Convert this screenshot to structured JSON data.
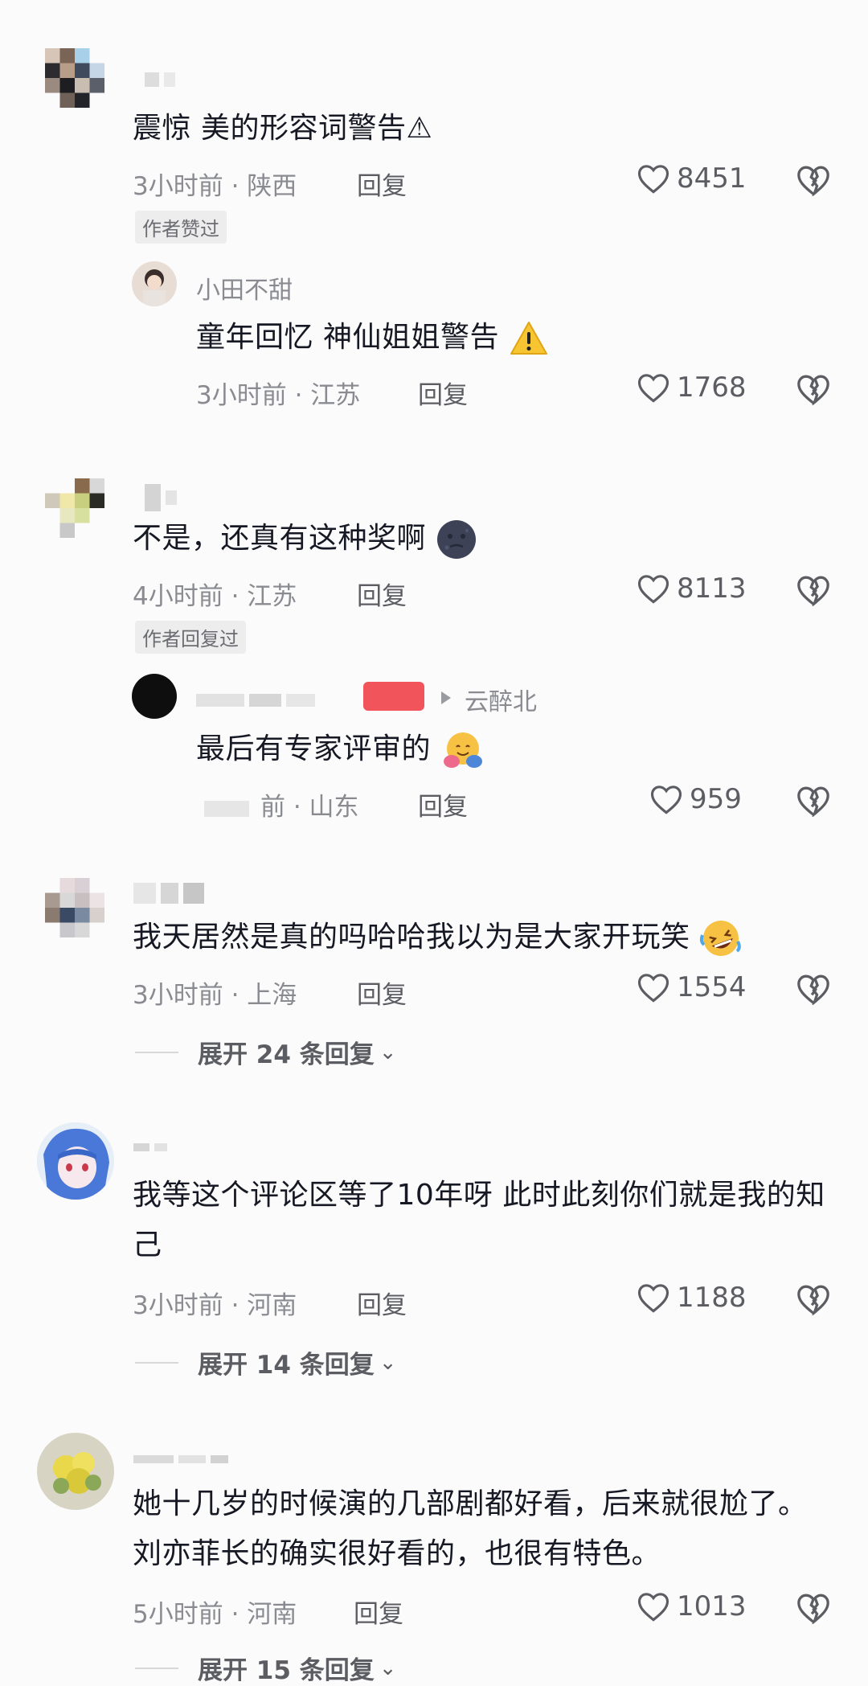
{
  "comments": [
    {
      "text": "震惊 美的形容词警告⚠",
      "time": "3小时前 · 陕西",
      "reply": "回复",
      "likes": "8451",
      "tag": "作者赞过"
    },
    {
      "name": "小田不甜",
      "text": "童年回忆 神仙姐姐警告",
      "time": "3小时前 · 江苏",
      "reply": "回复",
      "likes": "1768"
    },
    {
      "text": "不是，还真有这种奖啊",
      "time": "4小时前 · 江苏",
      "reply": "回复",
      "likes": "8113",
      "tag": "作者回复过"
    },
    {
      "reply_to": "云醉北",
      "text": "最后有专家评审的",
      "time": "前 · 山东",
      "reply": "回复",
      "likes": "959"
    },
    {
      "text": "我天居然是真的吗哈哈我以为是大家开玩笑",
      "time": "3小时前 · 上海",
      "reply": "回复",
      "likes": "1554",
      "expand": "展开 24 条回复"
    },
    {
      "text": "我等这个评论区等了10年呀 此时此刻你们就是我的知己",
      "time": "3小时前 · 河南",
      "reply": "回复",
      "likes": "1188",
      "expand": "展开 14 条回复"
    },
    {
      "text": "她十几岁的时候演的几部剧都好看，后来就很尬了。刘亦菲长的确实很好看的，也很有特色。",
      "time": "5小时前 · 河南",
      "reply": "回复",
      "likes": "1013",
      "expand": "展开 15 条回复"
    }
  ],
  "colors": {
    "text": "#161823",
    "meta": "#8a8b91",
    "tag_bg": "#ededed",
    "badge": "#f2545b"
  },
  "icons": {
    "like": "heart-outline-icon",
    "dislike": "broken-heart-icon",
    "expand": "chevron-down-icon",
    "warning": "warning-icon",
    "reply_arrow": "triangle-right-icon"
  }
}
